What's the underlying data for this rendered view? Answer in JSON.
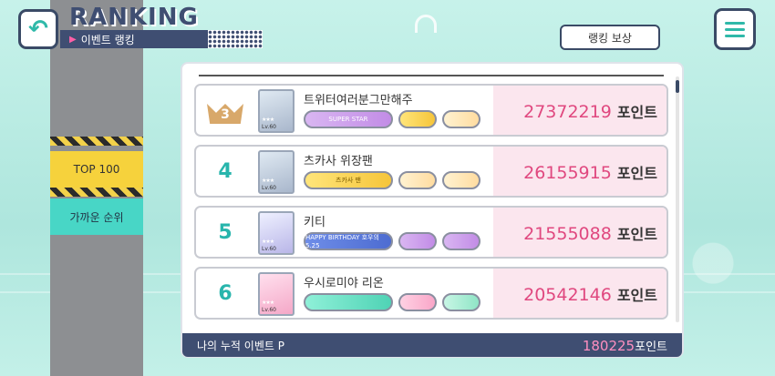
{
  "header": {
    "title": "RANKING",
    "subtitle": "이벤트 랭킹",
    "reward_button": "랭킹 보상"
  },
  "tabs": [
    {
      "label": "TOP 100"
    },
    {
      "label": "가까운 순위"
    }
  ],
  "rankings": [
    {
      "rank": "3",
      "name": "트위터여러분그만해주",
      "score": "27372219",
      "unit": "포인트",
      "badge_main": "SUPER STAR",
      "level": "Lv.60"
    },
    {
      "rank": "4",
      "name": "츠카사 위장팬",
      "score": "26155915",
      "unit": "포인트",
      "badge_main": "츠카사 팬",
      "level": "Lv.60"
    },
    {
      "rank": "5",
      "name": "키티",
      "score": "21555088",
      "unit": "포인트",
      "badge_main": "HAPPY BIRTHDAY 호우의 5.25",
      "level": "Lv.60"
    },
    {
      "rank": "6",
      "name": "우시로미야 리온",
      "score": "20542146",
      "unit": "포인트",
      "badge_main": "",
      "level": "Lv.60"
    }
  ],
  "footer": {
    "label": "나의 누적 이벤트 P",
    "value": "180225",
    "unit": "포인트"
  },
  "colors": {
    "accent_teal": "#2fb9a9",
    "navy": "#3f4e72",
    "score_pink": "#e0487f",
    "tab_yellow": "#f6d23c",
    "tab_teal": "#48d6c6"
  }
}
